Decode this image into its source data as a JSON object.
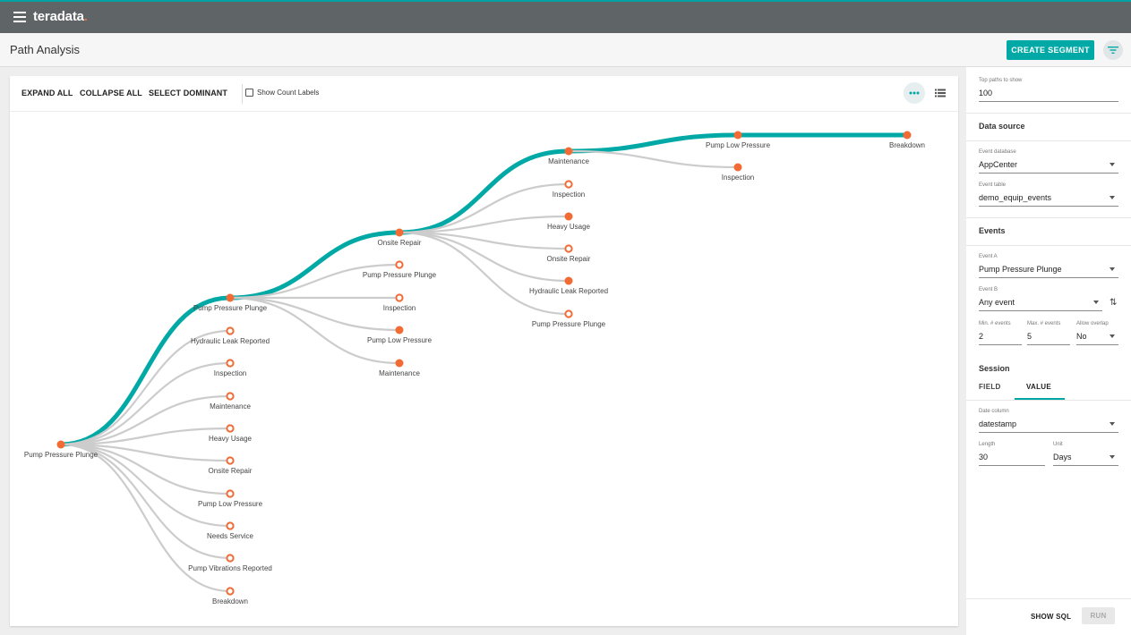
{
  "app": {
    "brand": "teradata",
    "brand_dot": "."
  },
  "header": {
    "title": "Path Analysis",
    "create_segment": "CREATE SEGMENT"
  },
  "toolbar": {
    "expand_all": "EXPAND ALL",
    "collapse_all": "COLLAPSE ALL",
    "select_dominant": "SELECT DOMINANT",
    "show_count_labels": "Show Count Labels",
    "show_count_labels_checked": false
  },
  "tree": {
    "root": "Pump Pressure Plunge",
    "level1": [
      "Pump Pressure Plunge",
      "Hydraulic Leak Reported",
      "Inspection",
      "Maintenance",
      "Heavy Usage",
      "Onsite Repair",
      "Pump Low Pressure",
      "Needs Service",
      "Pump Vibrations Reported",
      "Breakdown"
    ],
    "level2": [
      "Onsite Repair",
      "Pump Pressure Plunge",
      "Inspection",
      "Pump Low Pressure",
      "Maintenance"
    ],
    "level3": [
      "Maintenance",
      "Inspection",
      "Heavy Usage",
      "Onsite Repair",
      "Hydraulic Leak Reported",
      "Pump Pressure Plunge"
    ],
    "level4": [
      "Pump Low Pressure",
      "Inspection"
    ],
    "level5": [
      "Breakdown"
    ],
    "colors": {
      "dominant": "#00a9a5",
      "branch": "#cccccc",
      "node": "#f26b35"
    }
  },
  "panel": {
    "top_paths_label": "Top paths to show",
    "top_paths_value": "100",
    "data_source_heading": "Data source",
    "event_database_label": "Event database",
    "event_database_value": "AppCenter",
    "event_table_label": "Event table",
    "event_table_value": "demo_equip_events",
    "events_heading": "Events",
    "event_a_label": "Event A",
    "event_a_value": "Pump Pressure Plunge",
    "event_b_label": "Event B",
    "event_b_value": "Any event",
    "min_events_label": "Min. # events",
    "min_events_value": "2",
    "max_events_label": "Max. # events",
    "max_events_value": "5",
    "allow_overlap_label": "Allow overlap",
    "allow_overlap_value": "No",
    "session_heading": "Session",
    "tab_field": "FIELD",
    "tab_value": "VALUE",
    "date_column_label": "Date column",
    "date_column_value": "datestamp",
    "length_label": "Length",
    "length_value": "30",
    "unit_label": "Unit",
    "unit_value": "Days",
    "show_sql": "SHOW SQL",
    "run": "RUN"
  }
}
